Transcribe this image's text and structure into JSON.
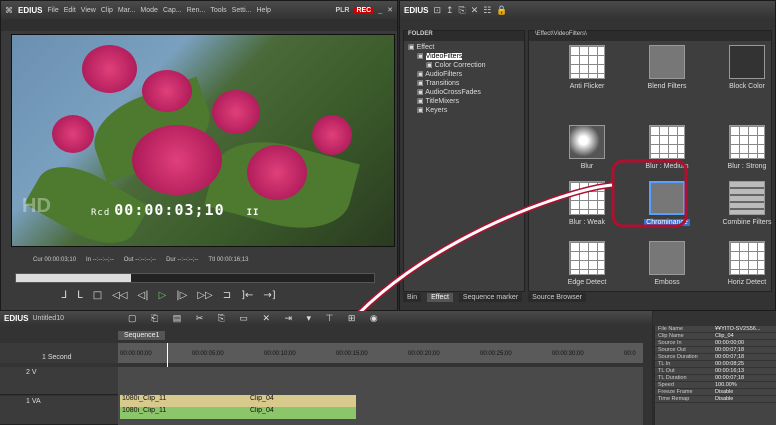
{
  "player": {
    "brand": "EDIUS",
    "menu": [
      "File",
      "Edit",
      "View",
      "Clip",
      "Mar...",
      "Mode",
      "Cap...",
      "Ren...",
      "Tools",
      "Setti...",
      "Help"
    ],
    "mode_label": "PLR",
    "rec_label": "REC",
    "overlay_logo": "HD",
    "timecode_prefix": "Rcd",
    "timecode": "00:00:03;10",
    "pause_mark": "II",
    "cur_label": "Cur",
    "cur_value": "00:00:03;10",
    "in_label": "In",
    "in_value": "--:--:--;--",
    "out_label": "Out",
    "out_value": "--:--:--;--",
    "dur_label": "Dur",
    "dur_value": "--:--:--;--",
    "ttl_label": "Ttl",
    "ttl_value": "00:00:16;13",
    "scrub_progress": 0.32
  },
  "effects_window": {
    "brand": "EDIUS",
    "folder_header": "FOLDER",
    "path": "\\Effect\\VideoFilters\\",
    "tree": [
      {
        "label": "Effect",
        "indent": 0
      },
      {
        "label": "VideoFilters",
        "indent": 1,
        "selected": true
      },
      {
        "label": "Color Correction",
        "indent": 2
      },
      {
        "label": "AudioFilters",
        "indent": 1
      },
      {
        "label": "Transitions",
        "indent": 1
      },
      {
        "label": "AudioCrossFades",
        "indent": 1
      },
      {
        "label": "TitleMixers",
        "indent": 1
      },
      {
        "label": "Keyers",
        "indent": 1
      }
    ],
    "items": [
      {
        "label": "Anti Flicker",
        "thumb": "grid"
      },
      {
        "label": "Blend Filters",
        "thumb": "gray"
      },
      {
        "label": "Block Color",
        "thumb": "dark"
      },
      {
        "label": "Blur",
        "thumb": "blur"
      },
      {
        "label": "Blur : Medium",
        "thumb": "grid"
      },
      {
        "label": "Blur : Strong",
        "thumb": "grid"
      },
      {
        "label": "Blur : Weak",
        "thumb": "grid"
      },
      {
        "label": "Chrominance",
        "thumb": "gray",
        "selected": true
      },
      {
        "label": "Combine Filters",
        "thumb": "stack"
      },
      {
        "label": "Edge Detect",
        "thumb": "grid"
      },
      {
        "label": "Emboss",
        "thumb": "gray"
      },
      {
        "label": "Horiz Detect",
        "thumb": "grid"
      }
    ],
    "tabs": [
      "Bin",
      "Effect",
      "Sequence marker",
      "Source Browser"
    ],
    "active_tab": "Effect"
  },
  "timeline": {
    "brand": "EDIUS",
    "project": "Untitled10",
    "sequence": "Sequence1",
    "scale": "1 Second",
    "ruler": [
      "00:00:00;00",
      "00:00:05;00",
      "00:00:10;00",
      "00:00:15;00",
      "00:00:20;00",
      "00:00:25;00",
      "00:00:30;00",
      "00:0"
    ],
    "tracks": [
      {
        "name": "2 V"
      },
      {
        "name": "1 VA"
      }
    ],
    "clips": [
      {
        "label": "1080i_Clip_11",
        "row": "video",
        "color": "#d8c98c"
      },
      {
        "label": "Clip_04",
        "row": "video",
        "color": "#d8c98c"
      },
      {
        "label": "1080i_Clip_11",
        "row": "audio",
        "color": "#8cc66a"
      },
      {
        "label": "Clip_04",
        "row": "audio",
        "color": "#8cc66a"
      }
    ]
  },
  "info_panel": [
    {
      "k": "File Name",
      "v": "¥¥YITO-SV2S56..."
    },
    {
      "k": "Clip Name",
      "v": "Clip_04"
    },
    {
      "k": "Source In",
      "v": "00:00:00;00"
    },
    {
      "k": "Source Out",
      "v": "00:00:07;18"
    },
    {
      "k": "Source Duration",
      "v": "00:00:07;18"
    },
    {
      "k": "TL In",
      "v": "00:00:08;25"
    },
    {
      "k": "TL Out",
      "v": "00:00:16;13"
    },
    {
      "k": "TL Duration",
      "v": "00:00:07;18"
    },
    {
      "k": "Speed",
      "v": "100.00%"
    },
    {
      "k": "Freeze Frame",
      "v": "Disable"
    },
    {
      "k": "Time Remap",
      "v": "Disable"
    }
  ]
}
